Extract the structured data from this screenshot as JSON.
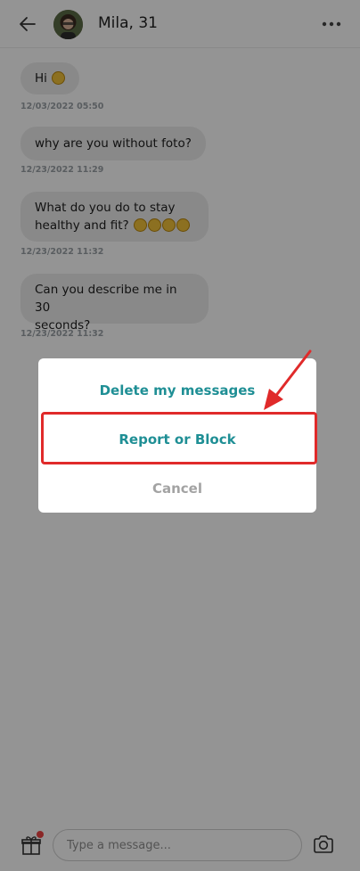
{
  "header": {
    "name": "Mila, 31"
  },
  "messages": [
    {
      "text": "Hi",
      "emoji_count": 1,
      "time": "12/03/2022 05:50"
    },
    {
      "text": "why are you without foto?",
      "emoji_count": 0,
      "time": "12/23/2022 11:29"
    },
    {
      "text_line1": "What do you do to stay",
      "text_line2": "healthy and fit?",
      "emoji_count": 4,
      "time": "12/23/2022 11:32"
    },
    {
      "text_line1": "Can you describe me in 30",
      "text_line2": "seconds?",
      "emoji_count": 0,
      "time": "12/23/2022 11:32"
    }
  ],
  "composer": {
    "placeholder": "Type a message..."
  },
  "modal": {
    "delete_label": "Delete my messages",
    "report_label": "Report or Block",
    "cancel_label": "Cancel"
  },
  "colors": {
    "accent": "#1f8f95",
    "highlight": "#e02a2a"
  }
}
